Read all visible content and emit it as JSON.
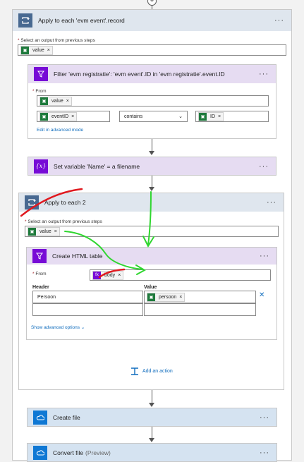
{
  "apply_each_outer": {
    "title": "Apply to each 'evm event'.record",
    "select_label": "Select an output from previous steps",
    "token": "value"
  },
  "filter": {
    "title": "Filter 'evm registratie': 'evm event'.ID in 'evm registratie'.event.ID",
    "from_label": "From",
    "from_token": "value",
    "left_token": "eventID",
    "operator": "contains",
    "right_token": "ID",
    "edit_link": "Edit in advanced mode"
  },
  "set_variable": {
    "title": "Set variable 'Name' = a filename",
    "icon": "{x}"
  },
  "apply_each_inner": {
    "title": "Apply to each 2",
    "select_label": "Select an output from previous steps",
    "token": "value"
  },
  "html_table": {
    "title": "Create HTML table",
    "from_label": "From",
    "from_token": "body",
    "header_col": "Header",
    "value_col": "Value",
    "header_cell": "Persoon",
    "value_token": "persoon",
    "advanced": "Show advanced options"
  },
  "add_action": "Add an action",
  "create_file": {
    "title": "Create file"
  },
  "convert_file": {
    "title": "Convert file",
    "suffix": "(Preview)"
  },
  "menu": "···",
  "icons": [
    "loop-icon",
    "filter-icon",
    "variable-icon",
    "onedrive-icon",
    "token-icon",
    "add-action-icon"
  ],
  "colors": {
    "loop_header": "#dfe6ee",
    "loop_icon": "#486991",
    "variable_header": "#e6dcf2",
    "variable_icon": "#770bd6",
    "onedrive_header": "#d5e3f1",
    "onedrive_icon": "#0f78d4",
    "token_green": "#1e7a3c",
    "annotation_red": "#e0191f",
    "annotation_green": "#2fd62f"
  }
}
